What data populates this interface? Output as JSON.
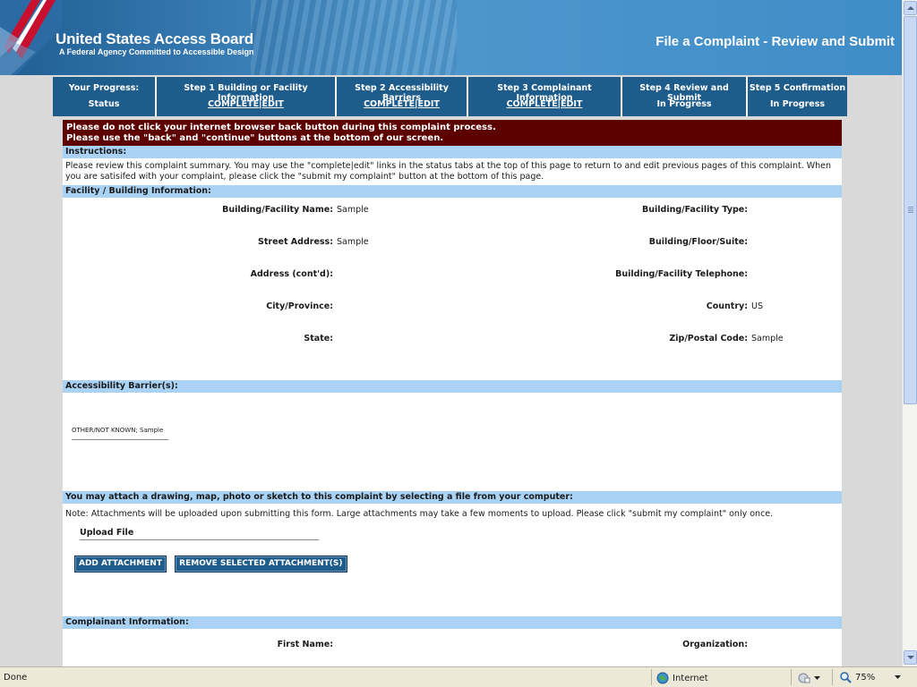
{
  "header": {
    "title": "United States Access Board",
    "subtitle": "A Federal Agency Committed to Accessible Design",
    "page_heading": "File a Complaint - Review and Submit"
  },
  "progress": {
    "status_label": "Your Progress:",
    "status_value": "Status",
    "steps": [
      {
        "label": "Step 1  Building or Facility Information",
        "status": "COMPLETE|EDIT"
      },
      {
        "label": "Step 2  Accessibility Barriers",
        "status": "COMPLETE|EDIT"
      },
      {
        "label": "Step 3  Complainant Information",
        "status": "COMPLETE|EDIT"
      },
      {
        "label": "Step 4  Review and Submit",
        "status": "In Progress"
      },
      {
        "label": "Step 5  Confirmation",
        "status": "In Progress"
      }
    ]
  },
  "warning": {
    "line1": "Please do not click your internet browser back button during this complaint process.",
    "line2": "Please use the \"back\" and \"continue\" buttons at the bottom of our screen."
  },
  "instructions": {
    "heading": "Instructions:",
    "text": "Please review this complaint summary. You may use the \"complete|edit\" links in the status tabs at the top of this page to return to and edit previous pages of this complaint. When you are satisifed with your complaint, please click the \"submit my complaint\" button at the bottom of this page."
  },
  "facility": {
    "heading": "Facility / Building Information:",
    "rows": [
      {
        "left_label": "Building/Facility Name:",
        "left_value": "Sample",
        "right_label": "Building/Facility Type:",
        "right_value": ""
      },
      {
        "left_label": "Street Address:",
        "left_value": "Sample",
        "right_label": "Building/Floor/Suite:",
        "right_value": ""
      },
      {
        "left_label": "Address (cont'd):",
        "left_value": "",
        "right_label": "Building/Facility Telephone:",
        "right_value": ""
      },
      {
        "left_label": "City/Province:",
        "left_value": "",
        "right_label": "Country:",
        "right_value": "US"
      },
      {
        "left_label": "State:",
        "left_value": "",
        "right_label": "Zip/Postal Code:",
        "right_value": "Sample"
      }
    ]
  },
  "barriers": {
    "heading": "Accessibility Barrier(s):",
    "item": "OTHER/NOT KNOWN; Sample"
  },
  "attachments": {
    "heading": "You may attach a drawing, map, photo or sketch to this complaint by selecting a file from your computer:",
    "note": "Note: Attachments will be uploaded upon submitting this form. Large attachments may take a few moments to upload. Please click \"submit my complaint\" only once.",
    "upload_label": "Upload File",
    "add_button": "ADD ATTACHMENT",
    "remove_button": "REMOVE SELECTED ATTACHMENT(S)"
  },
  "complainant": {
    "heading": "Complainant Information:",
    "left_label": "First Name:",
    "right_label": "Organization:"
  },
  "statusbar": {
    "status": "Done",
    "zone": "Internet",
    "zoom": "75%"
  },
  "colors": {
    "banner": "#3a7fb7",
    "tab": "#1e5c8c",
    "warning": "#5c0000",
    "section_bar": "#a9d2f5"
  }
}
